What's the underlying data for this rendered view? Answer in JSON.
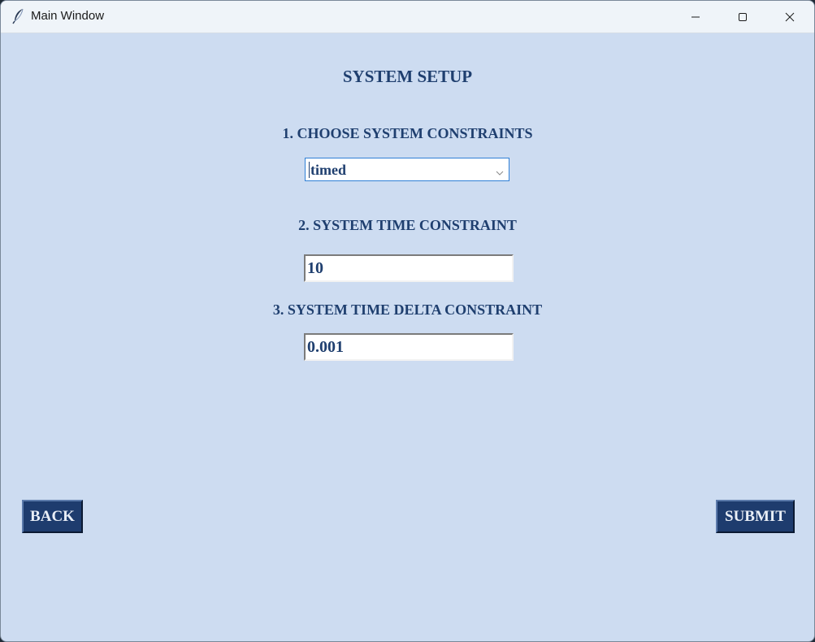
{
  "window": {
    "title": "Main Window",
    "app_icon": "feather-icon"
  },
  "window_controls": {
    "minimize_icon": "minimize-icon",
    "maximize_icon": "maximize-icon",
    "close_icon": "close-icon"
  },
  "form": {
    "title": "SYSTEM SETUP",
    "section1_label": "1. CHOOSE SYSTEM CONSTRAINTS",
    "constraint_type_value": "timed",
    "section2_label": "2. SYSTEM TIME CONSTRAINT",
    "time_constraint_value": "10",
    "section3_label": "3. SYSTEM TIME DELTA CONSTRAINT",
    "time_delta_value": "0.001"
  },
  "buttons": {
    "back_label": "BACK",
    "submit_label": "SUBMIT"
  },
  "colors": {
    "background": "#cddcf1",
    "label_text": "#1f3f6f",
    "button_bg": "#1e3c6e",
    "button_text": "#e9eef6",
    "combo_border": "#2f7fd6",
    "titlebar": "#eff4f9"
  }
}
